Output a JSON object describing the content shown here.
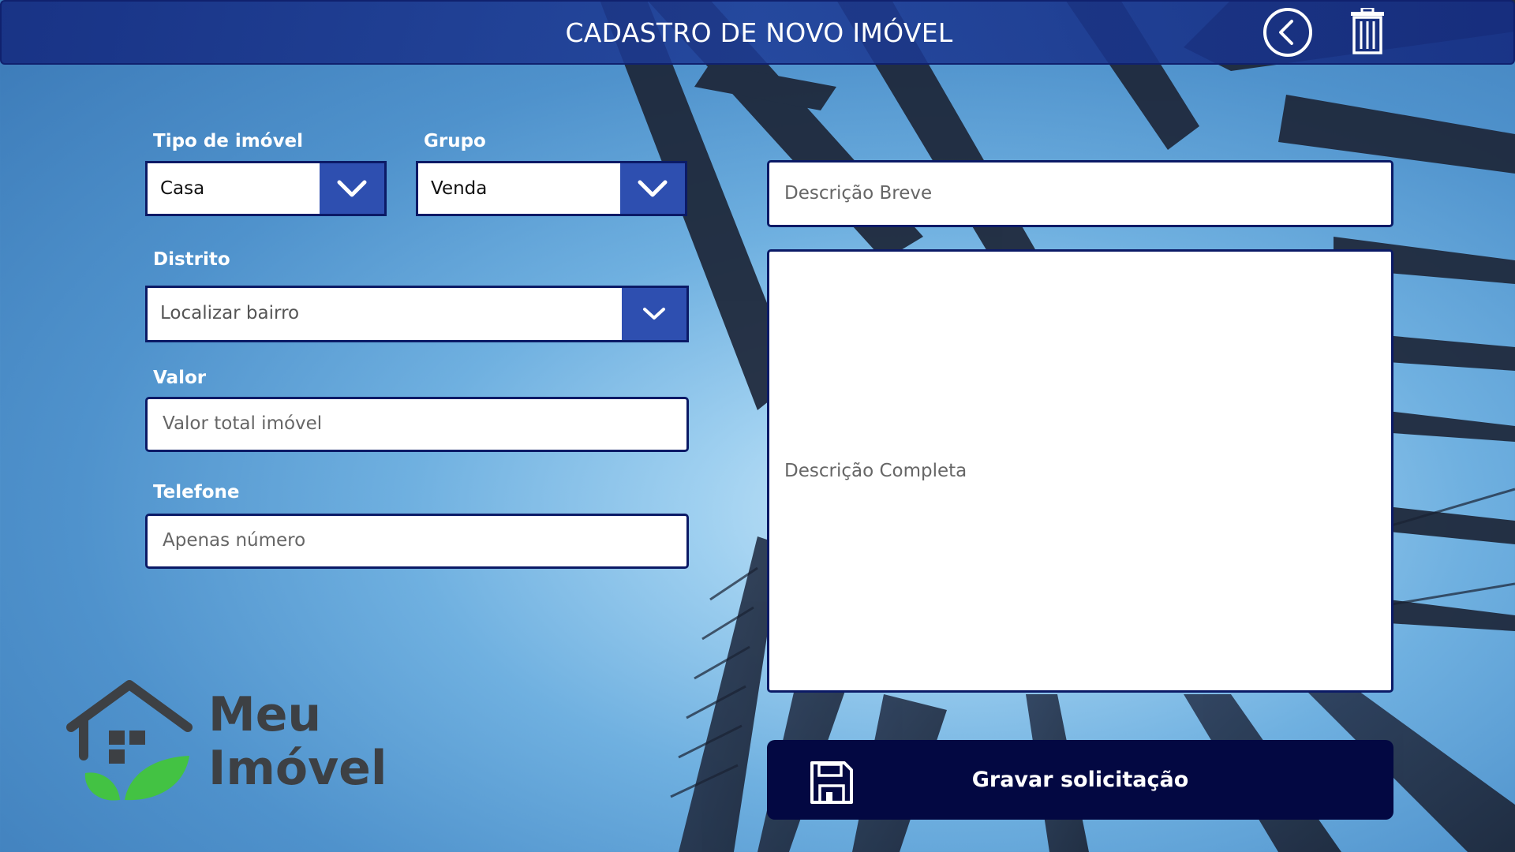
{
  "header": {
    "title": "CADASTRO DE NOVO IMÓVEL",
    "back_icon": "back-arrow-circle-icon",
    "trash_icon": "trash-icon"
  },
  "form": {
    "tipo": {
      "label": "Tipo de imóvel",
      "value": "Casa"
    },
    "grupo": {
      "label": "Grupo",
      "value": "Venda"
    },
    "distrito": {
      "label": "Distrito",
      "placeholder": "Localizar bairro"
    },
    "valor": {
      "label": "Valor",
      "placeholder": "Valor total imóvel"
    },
    "telefone": {
      "label": "Telefone",
      "placeholder": "Apenas número"
    },
    "descricao_breve": {
      "placeholder": "Descrição Breve"
    },
    "descricao_completa": {
      "placeholder": "Descrição Completa"
    }
  },
  "save_button": {
    "label": "Gravar solicitação",
    "icon": "floppy-disk-icon"
  },
  "logo": {
    "line1": "Meu",
    "line2": "Imóvel"
  },
  "colors": {
    "header_bg": "#1f3a96",
    "border": "#0b1a66",
    "dropdown_accent": "#2e4fb0",
    "save_bg": "#030842",
    "logo_text": "#3d4044",
    "leaf_green": "#3fbf3f"
  }
}
